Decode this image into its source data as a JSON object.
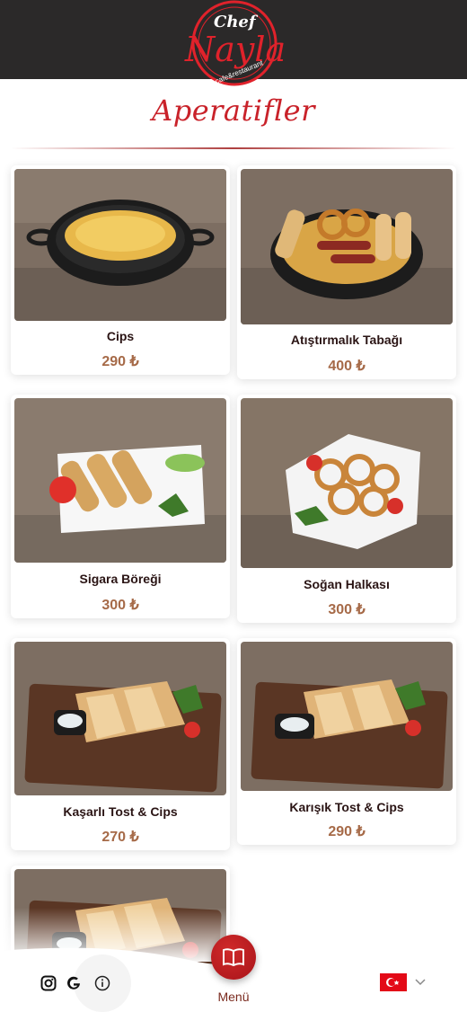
{
  "header": {
    "logo": {
      "chef": "Chef",
      "name": "Nayla",
      "tagline": "cafe&restaurant"
    }
  },
  "section": {
    "title": "Aperatifler"
  },
  "items": [
    {
      "name": "Cips",
      "price": "290 ₺"
    },
    {
      "name": "Atıştırmalık Tabağı",
      "price": "400 ₺"
    },
    {
      "name": "Sigara Böreği",
      "price": "300 ₺"
    },
    {
      "name": "Soğan Halkası",
      "price": "300 ₺"
    },
    {
      "name": "Kaşarlı Tost & Cips",
      "price": "270 ₺"
    },
    {
      "name": "Karışık Tost & Cips",
      "price": "290 ₺"
    }
  ],
  "bottom_nav": {
    "menu_label": "Menü",
    "icons": [
      "instagram-icon",
      "google-icon",
      "info-icon",
      "menu-book-icon",
      "turkey-flag-icon",
      "chevron-down-icon"
    ]
  },
  "colors": {
    "accent": "#c9222a",
    "price": "#a66a48",
    "topbar": "#2b2929"
  }
}
